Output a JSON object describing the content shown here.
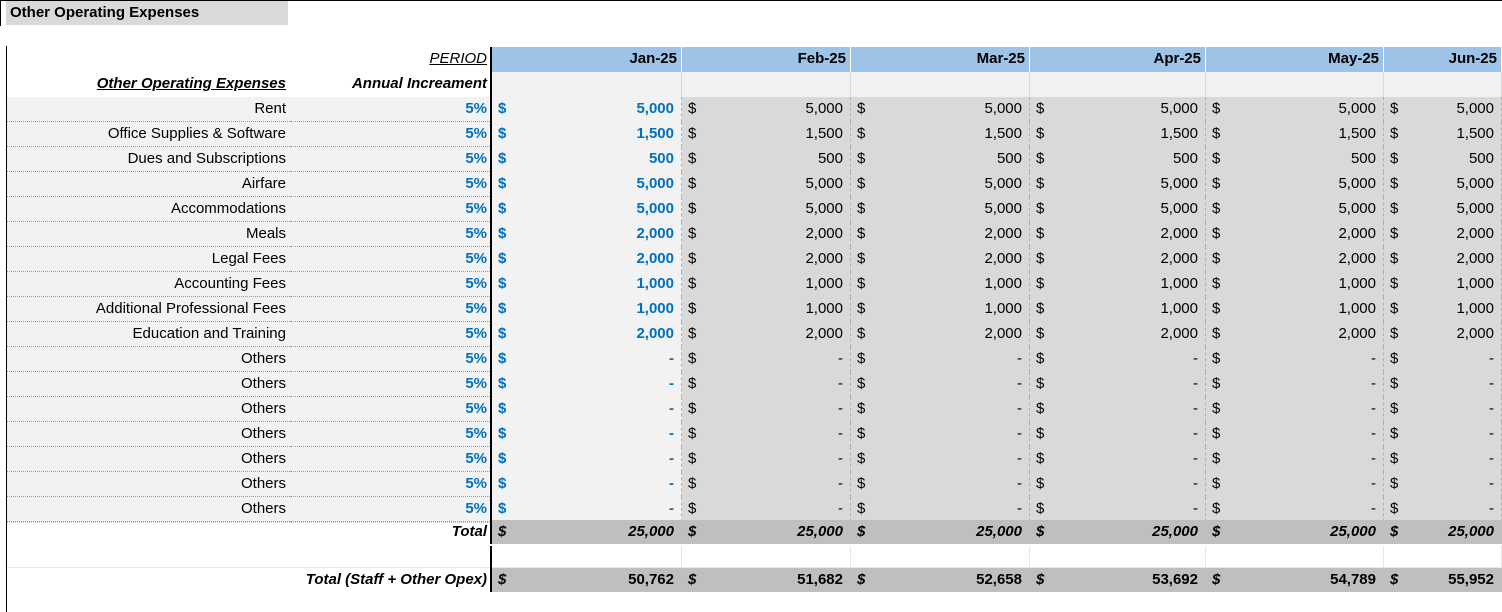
{
  "title": "Other Operating Expenses",
  "header": {
    "period_label": "PERIOD",
    "months": [
      "Jan-25",
      "Feb-25",
      "Mar-25",
      "Apr-25",
      "May-25",
      "Jun-25"
    ]
  },
  "subheader": {
    "section_label": "Other Operating Expenses",
    "increment_label": "Annual Increament"
  },
  "currency_symbol": "$",
  "rows": [
    {
      "label": "Rent",
      "increment": "5%",
      "values": [
        "5,000",
        "5,000",
        "5,000",
        "5,000",
        "5,000",
        "5,000"
      ]
    },
    {
      "label": "Office Supplies & Software",
      "increment": "5%",
      "values": [
        "1,500",
        "1,500",
        "1,500",
        "1,500",
        "1,500",
        "1,500"
      ]
    },
    {
      "label": "Dues and Subscriptions",
      "increment": "5%",
      "values": [
        "500",
        "500",
        "500",
        "500",
        "500",
        "500"
      ]
    },
    {
      "label": "Airfare",
      "increment": "5%",
      "values": [
        "5,000",
        "5,000",
        "5,000",
        "5,000",
        "5,000",
        "5,000"
      ]
    },
    {
      "label": "Accommodations",
      "increment": "5%",
      "values": [
        "5,000",
        "5,000",
        "5,000",
        "5,000",
        "5,000",
        "5,000"
      ]
    },
    {
      "label": "Meals",
      "increment": "5%",
      "values": [
        "2,000",
        "2,000",
        "2,000",
        "2,000",
        "2,000",
        "2,000"
      ]
    },
    {
      "label": "Legal Fees",
      "increment": "5%",
      "values": [
        "2,000",
        "2,000",
        "2,000",
        "2,000",
        "2,000",
        "2,000"
      ]
    },
    {
      "label": "Accounting Fees",
      "increment": "5%",
      "values": [
        "1,000",
        "1,000",
        "1,000",
        "1,000",
        "1,000",
        "1,000"
      ]
    },
    {
      "label": "Additional Professional Fees",
      "increment": "5%",
      "values": [
        "1,000",
        "1,000",
        "1,000",
        "1,000",
        "1,000",
        "1,000"
      ]
    },
    {
      "label": "Education and Training",
      "increment": "5%",
      "values": [
        "2,000",
        "2,000",
        "2,000",
        "2,000",
        "2,000",
        "2,000"
      ]
    },
    {
      "label": "Others",
      "increment": "5%",
      "values": [
        "-",
        "-",
        "-",
        "-",
        "-",
        "-"
      ]
    },
    {
      "label": "Others",
      "increment": "5%",
      "values": [
        "-",
        "-",
        "-",
        "-",
        "-",
        "-"
      ]
    },
    {
      "label": "Others",
      "increment": "5%",
      "values": [
        "-",
        "-",
        "-",
        "-",
        "-",
        "-"
      ]
    },
    {
      "label": "Others",
      "increment": "5%",
      "values": [
        "-",
        "-",
        "-",
        "-",
        "-",
        "-"
      ]
    },
    {
      "label": "Others",
      "increment": "5%",
      "values": [
        "-",
        "-",
        "-",
        "-",
        "-",
        "-"
      ]
    },
    {
      "label": "Others",
      "increment": "5%",
      "values": [
        "-",
        "-",
        "-",
        "-",
        "-",
        "-"
      ]
    },
    {
      "label": "Others",
      "increment": "5%",
      "values": [
        "-",
        "-",
        "-",
        "-",
        "-",
        "-"
      ]
    }
  ],
  "total": {
    "label": "Total",
    "values": [
      "25,000",
      "25,000",
      "25,000",
      "25,000",
      "25,000",
      "25,000"
    ]
  },
  "grand_total": {
    "label": "Total (Staff + Other  Opex)",
    "values": [
      "50,762",
      "51,682",
      "52,658",
      "53,692",
      "54,789",
      "55,952"
    ]
  }
}
